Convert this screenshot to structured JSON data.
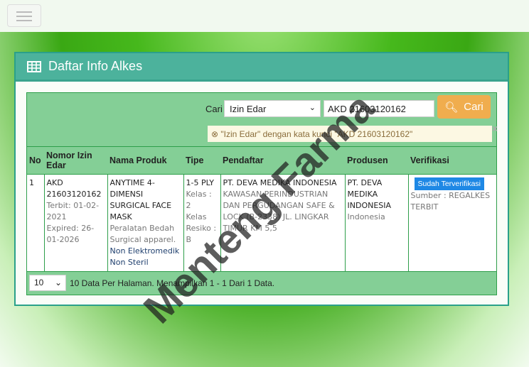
{
  "panel": {
    "title": "Daftar Info Alkes"
  },
  "search": {
    "label": "Cari",
    "field": "Izin Edar",
    "query": "AKD 21603120162",
    "button": "Cari",
    "alert": "\"Izin Edar\" dengan kata kunci \"AKD 21603120162\"",
    "alert_close": "×"
  },
  "table": {
    "headers": [
      "No",
      "Nomor Izin Edar",
      "Nama Produk",
      "Tipe",
      "Pendaftar",
      "Produsen",
      "Verifikasi"
    ],
    "rows": [
      {
        "no": "1",
        "nomor": "AKD 21603120162",
        "terbit": "Terbit: 01-02-2021",
        "expired": "Expired: 26-01-2026",
        "nama": "ANYTIME 4-DIMENSI SURGICAL FACE MASK",
        "kategori": "Peralatan Bedah",
        "subkategori": "Surgical apparel.",
        "jenis": "Non Elektromedik Non Steril",
        "tipe": "1-5 PLY",
        "kelas": "Kelas : 2",
        "resiko": "Kelas Resiko : B",
        "pendaftar": "PT. DEVA MEDIKA INDONESIA",
        "alamat": "KAWASAN PERINDUSTRIAN DAN PERGUDANGAN SAFE & LOCK (B-2338) JL. LINGKAR TIMUR KM 5,5",
        "produsen": "PT. DEVA MEDIKA INDONESIA",
        "negara": "Indonesia",
        "verifikasi": "Sudah Terverifikasi",
        "sumber": "Sumber : REGALKES TERBIT"
      }
    ]
  },
  "footer": {
    "per_page": "10",
    "info": "10 Data Per Halaman. Menampilkan 1 - 1 Dari 1 Data."
  },
  "watermark": "Menteng Farma",
  "colors": {
    "header": "#4cb29c",
    "table_green": "#84cf96",
    "button": "#f0ad4e",
    "badge": "#1e88e5"
  }
}
